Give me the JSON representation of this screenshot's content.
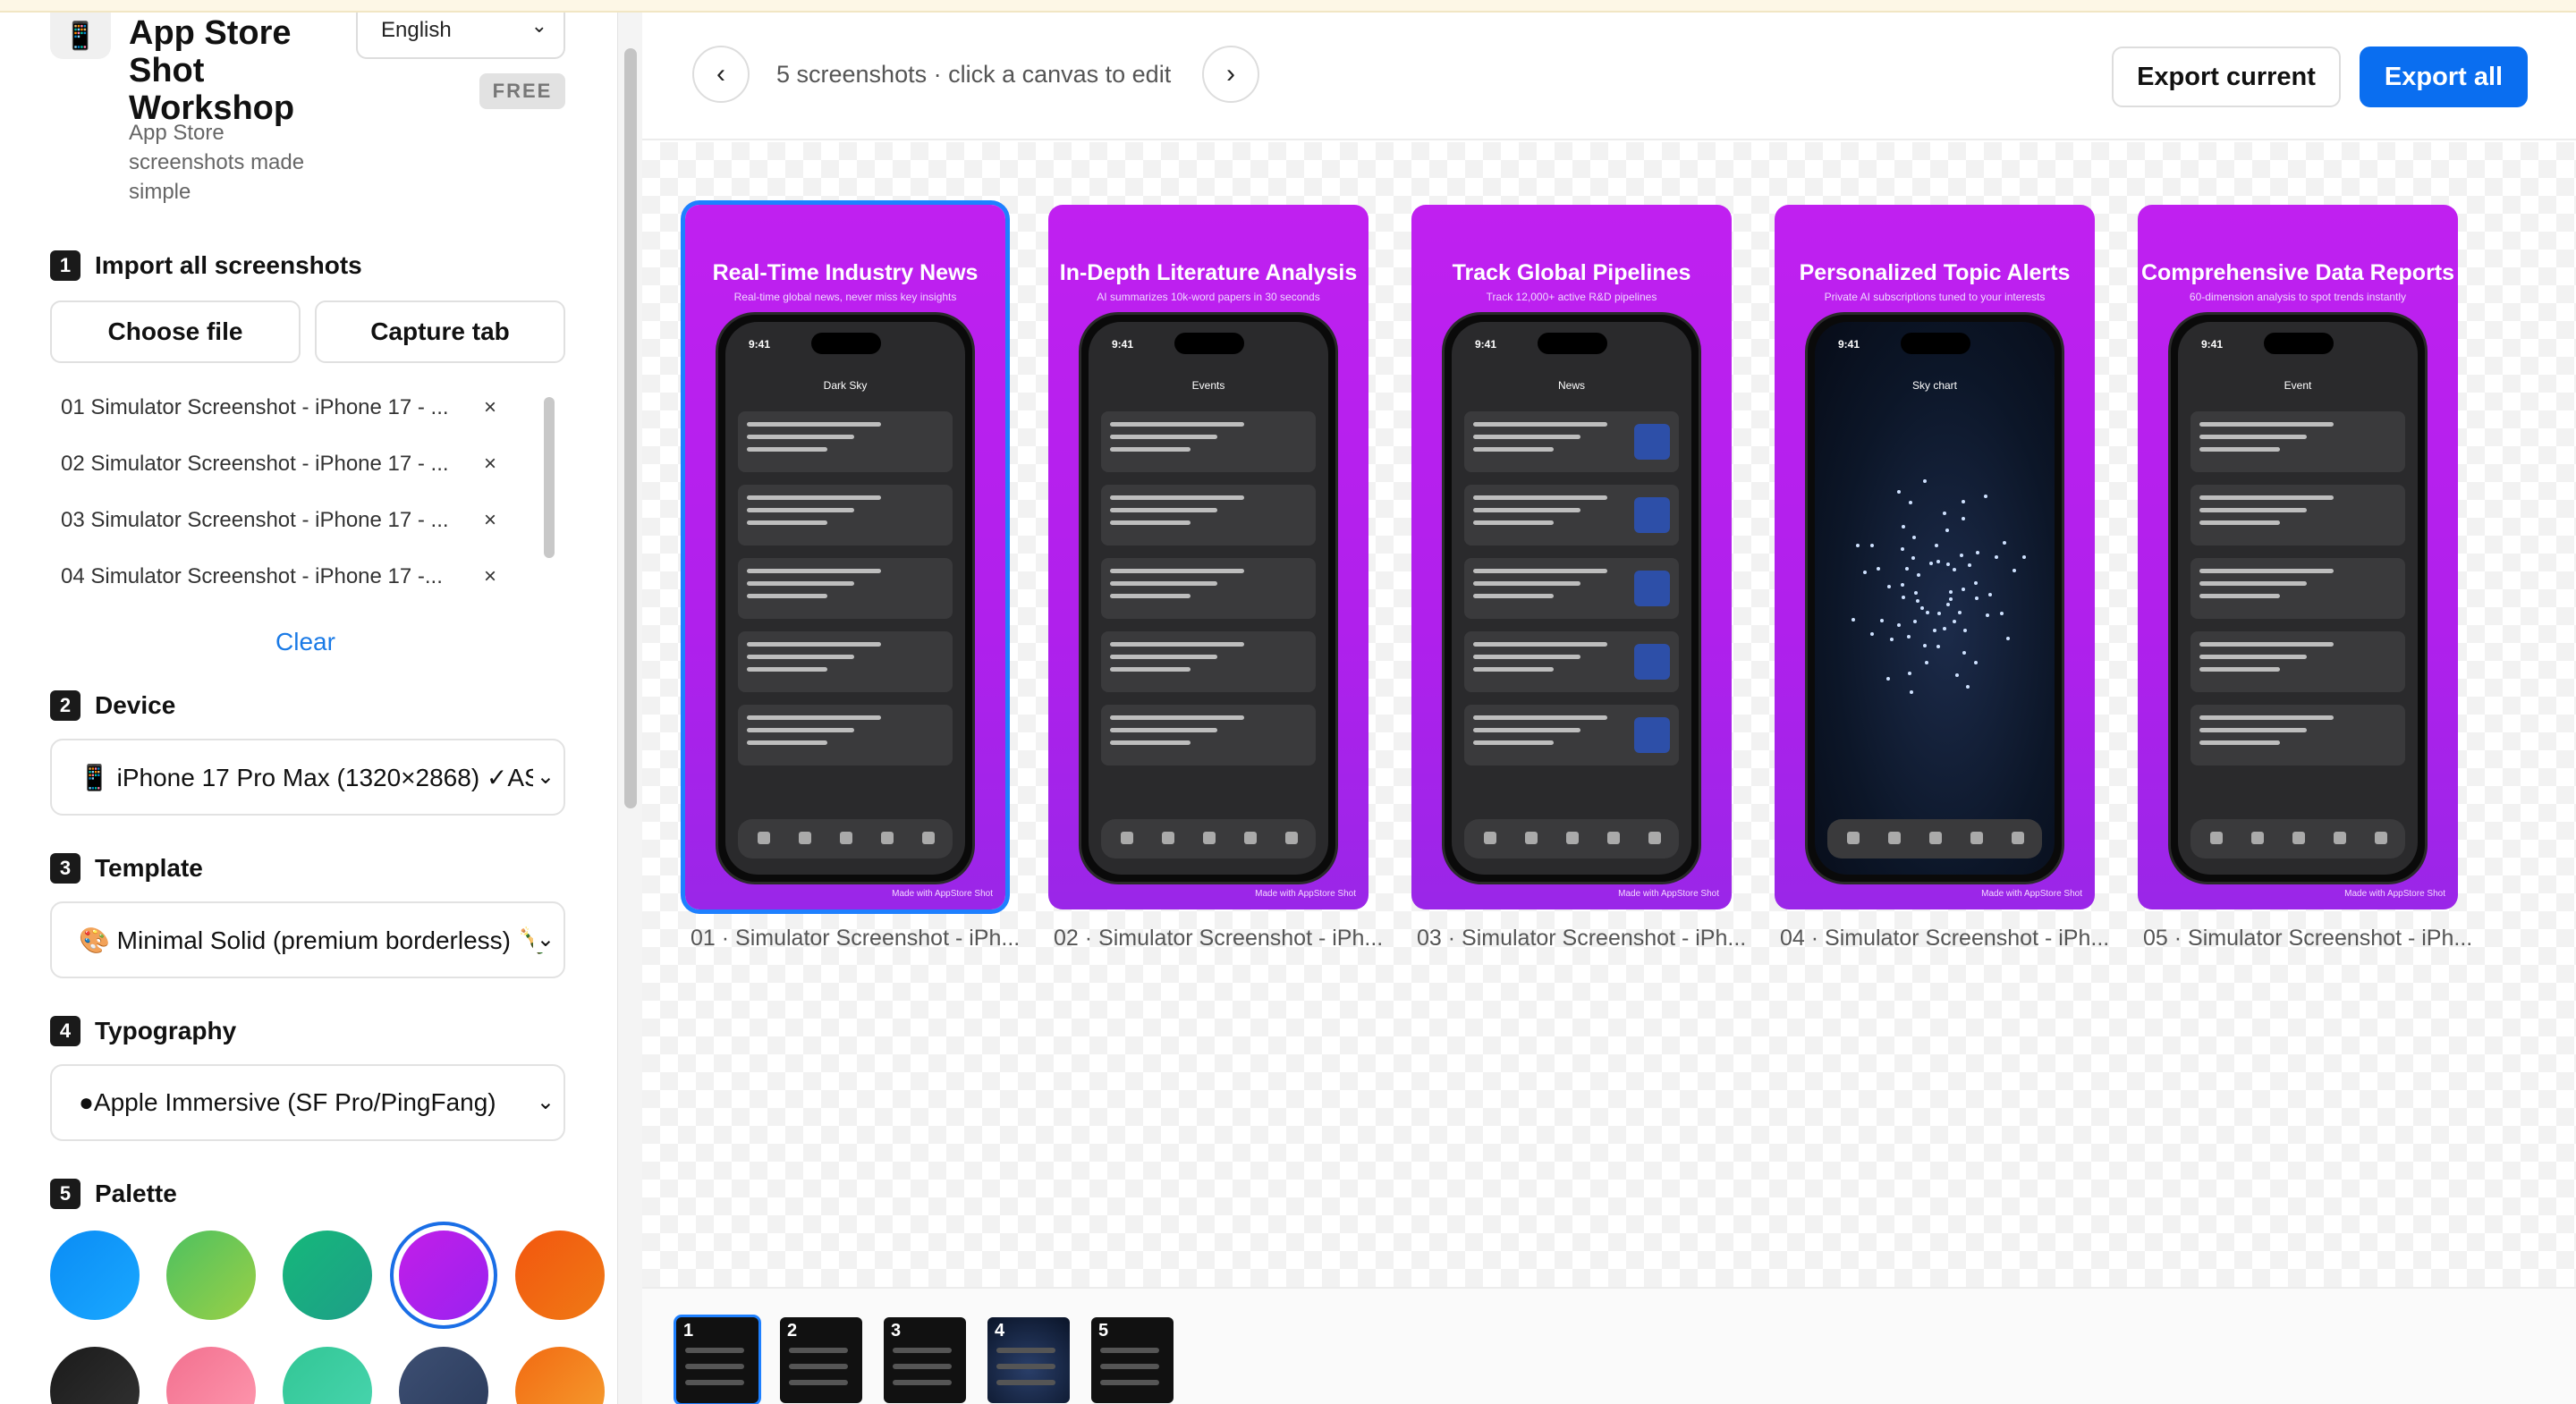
{
  "app": {
    "icon": "phone-icon",
    "title": "App Store Shot Workshop",
    "subtitle": "App Store screenshots made simple",
    "badge": "FREE"
  },
  "language": {
    "value": "English"
  },
  "sections": {
    "import": {
      "num": "1",
      "label": "Import all screenshots",
      "choose_file": "Choose file",
      "capture_tab": "Capture tab",
      "clear": "Clear"
    },
    "device": {
      "num": "2",
      "label": "Device",
      "value": "📱 iPhone 17 Pro Max (1320×2868) ✓AS"
    },
    "template": {
      "num": "3",
      "label": "Template",
      "value": "🎨 Minimal Solid (premium borderless) 🍾"
    },
    "typography": {
      "num": "4",
      "label": "Typography",
      "value": " Apple Immersive (SF Pro/PingFang)"
    },
    "palette": {
      "num": "5",
      "label": "Palette"
    }
  },
  "files": [
    {
      "name": "01  Simulator Screenshot - iPhone 17 - ..."
    },
    {
      "name": "02  Simulator Screenshot - iPhone 17 - ..."
    },
    {
      "name": "03  Simulator Screenshot - iPhone 17 - ..."
    },
    {
      "name": "04  Simulator Screenshot - iPhone 17 -..."
    }
  ],
  "palette": {
    "colors": [
      "#0a8cf5",
      "#4dc160",
      "#15b87a",
      "#c21ee8",
      "#f2560f",
      "#1b1b1b",
      "#f2708f",
      "#32c695",
      "#3d4f73",
      "#f26a12"
    ],
    "selected_index": 3
  },
  "toolbar": {
    "prev": "‹",
    "next": "›",
    "status": "5 screenshots · click a canvas to edit",
    "export_current": "Export current",
    "export_all": "Export all"
  },
  "cards": [
    {
      "headline": "Real-Time Industry News",
      "sub": "Real-time global news, never miss key insights",
      "time": "9:41",
      "caption": "Dark Sky",
      "label": "01 · Simulator Screenshot - iPh...",
      "made": "Made with AppStore Shot"
    },
    {
      "headline": "In-Depth Literature Analysis",
      "sub": "AI summarizes 10k-word papers in 30 seconds",
      "time": "9:41",
      "caption": "Events",
      "label": "02 · Simulator Screenshot - iPh...",
      "made": "Made with AppStore Shot"
    },
    {
      "headline": "Track Global Pipelines",
      "sub": "Track 12,000+ active R&D pipelines",
      "time": "9:41",
      "caption": "News",
      "label": "03 · Simulator Screenshot - iPh...",
      "made": "Made with AppStore Shot"
    },
    {
      "headline": "Personalized Topic Alerts",
      "sub": "Private AI subscriptions tuned to your interests",
      "time": "9:41",
      "caption": "Sky chart",
      "label": "04 · Simulator Screenshot - iPh...",
      "made": "Made with AppStore Shot"
    },
    {
      "headline": "Comprehensive Data Reports",
      "sub": "60-dimension analysis to spot trends instantly",
      "time": "9:41",
      "caption": "Event",
      "label": "05 · Simulator Screenshot - iPh...",
      "made": "Made with AppStore Shot"
    }
  ],
  "thumbnails": [
    {
      "n": "1"
    },
    {
      "n": "2"
    },
    {
      "n": "3"
    },
    {
      "n": "4"
    },
    {
      "n": "5"
    }
  ]
}
